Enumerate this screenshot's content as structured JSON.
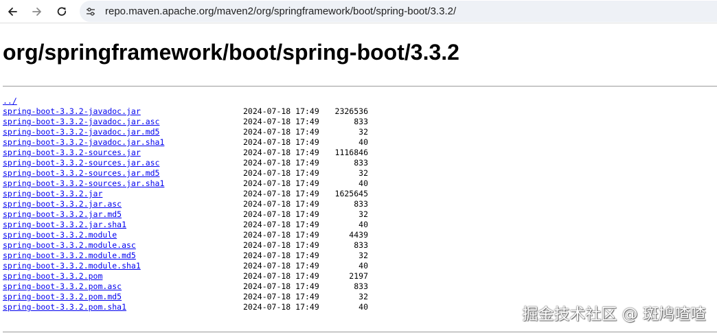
{
  "browser": {
    "url": "repo.maven.apache.org/maven2/org/springframework/boot/spring-boot/3.3.2/",
    "back_icon": "arrow-left",
    "forward_icon": "arrow-right",
    "reload_icon": "reload",
    "site_info_icon": "tune"
  },
  "page": {
    "title": "org/springframework/boot/spring-boot/3.3.2",
    "parent_link": "../",
    "files": [
      {
        "name": "spring-boot-3.3.2-javadoc.jar",
        "date": "2024-07-18 17:49",
        "size": "2326536"
      },
      {
        "name": "spring-boot-3.3.2-javadoc.jar.asc",
        "date": "2024-07-18 17:49",
        "size": "833"
      },
      {
        "name": "spring-boot-3.3.2-javadoc.jar.md5",
        "date": "2024-07-18 17:49",
        "size": "32"
      },
      {
        "name": "spring-boot-3.3.2-javadoc.jar.sha1",
        "date": "2024-07-18 17:49",
        "size": "40"
      },
      {
        "name": "spring-boot-3.3.2-sources.jar",
        "date": "2024-07-18 17:49",
        "size": "1116846"
      },
      {
        "name": "spring-boot-3.3.2-sources.jar.asc",
        "date": "2024-07-18 17:49",
        "size": "833"
      },
      {
        "name": "spring-boot-3.3.2-sources.jar.md5",
        "date": "2024-07-18 17:49",
        "size": "32"
      },
      {
        "name": "spring-boot-3.3.2-sources.jar.sha1",
        "date": "2024-07-18 17:49",
        "size": "40"
      },
      {
        "name": "spring-boot-3.3.2.jar",
        "date": "2024-07-18 17:49",
        "size": "1625645"
      },
      {
        "name": "spring-boot-3.3.2.jar.asc",
        "date": "2024-07-18 17:49",
        "size": "833"
      },
      {
        "name": "spring-boot-3.3.2.jar.md5",
        "date": "2024-07-18 17:49",
        "size": "32"
      },
      {
        "name": "spring-boot-3.3.2.jar.sha1",
        "date": "2024-07-18 17:49",
        "size": "40"
      },
      {
        "name": "spring-boot-3.3.2.module",
        "date": "2024-07-18 17:49",
        "size": "4439"
      },
      {
        "name": "spring-boot-3.3.2.module.asc",
        "date": "2024-07-18 17:49",
        "size": "833"
      },
      {
        "name": "spring-boot-3.3.2.module.md5",
        "date": "2024-07-18 17:49",
        "size": "32"
      },
      {
        "name": "spring-boot-3.3.2.module.sha1",
        "date": "2024-07-18 17:49",
        "size": "40"
      },
      {
        "name": "spring-boot-3.3.2.pom",
        "date": "2024-07-18 17:49",
        "size": "2197"
      },
      {
        "name": "spring-boot-3.3.2.pom.asc",
        "date": "2024-07-18 17:49",
        "size": "833"
      },
      {
        "name": "spring-boot-3.3.2.pom.md5",
        "date": "2024-07-18 17:49",
        "size": "32"
      },
      {
        "name": "spring-boot-3.3.2.pom.sha1",
        "date": "2024-07-18 17:49",
        "size": "40"
      }
    ]
  },
  "watermark": "掘金技术社区 @ 斑鸠喳喳",
  "colors": {
    "link": "#0000ee",
    "omnibox_bg": "#eef1f6",
    "rule": "#9a9a9a"
  }
}
